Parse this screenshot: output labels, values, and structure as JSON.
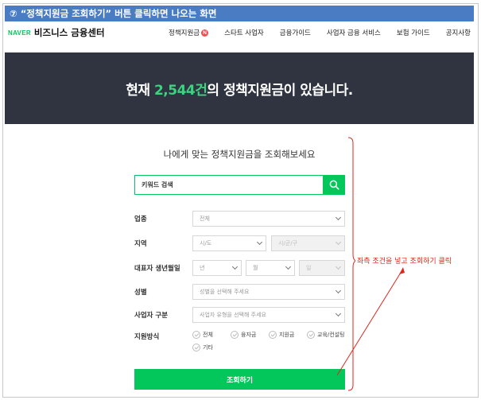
{
  "caption": "⑦ “정책지원금 조회하기” 버튼 클릭하면 나오는 화면",
  "header": {
    "logo_naver": "NAVER",
    "brand_name": "비즈니스 금융센터",
    "nav": [
      {
        "label": "정책지원금",
        "badge": "N"
      },
      {
        "label": "스타트 사업자"
      },
      {
        "label": "금융가이드"
      },
      {
        "label": "사업자 금융 서비스"
      },
      {
        "label": "보험 가이드"
      },
      {
        "label": "공지사항"
      }
    ]
  },
  "hero": {
    "prefix": "현재 ",
    "count": "2,544건",
    "suffix": "의 정책지원금이 있습니다."
  },
  "form": {
    "title": "나에게 맞는 정책지원금을 조회해보세요",
    "search_placeholder": "키워드 검색",
    "industry": {
      "label": "업종",
      "value": "전체"
    },
    "region": {
      "label": "지역",
      "city": "시/도",
      "district": "시/군/구"
    },
    "birth": {
      "label": "대표자 생년월일",
      "year": "년",
      "month": "월",
      "day": "일"
    },
    "gender": {
      "label": "성별",
      "value": "성별을 선택해 주세요"
    },
    "business_type": {
      "label": "사업자 구분",
      "value": "사업자 유형을 선택해 주세요"
    },
    "support": {
      "label": "지원방식",
      "options": [
        "전체",
        "융자금",
        "지원금",
        "교육/컨설팅",
        "기타"
      ]
    },
    "submit_label": "조회하기"
  },
  "annotation": "좌측 조건을 넣고 조회하기 클릭",
  "colors": {
    "accent_green": "#03c75a",
    "caption_blue": "#4a7cc4",
    "hero_bg": "#2f3440",
    "annotation_red": "#e0261c"
  }
}
